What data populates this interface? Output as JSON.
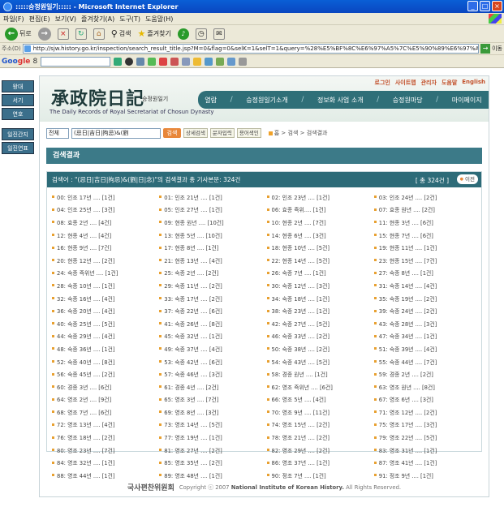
{
  "window": {
    "title": ":::::승정원일기::::: - Microsoft Internet Explorer"
  },
  "menu": [
    "파일(F)",
    "편집(E)",
    "보기(V)",
    "즐겨찾기(A)",
    "도구(T)",
    "도움말(H)"
  ],
  "toolbar": {
    "back_label": "뒤로",
    "search_label": "검색",
    "favorites_label": "즐겨찾기"
  },
  "address": {
    "label": "주소(D)",
    "url": "http://sjw.history.go.kr/inspection/search_result_title.jsp?M=0&flag=0&selK=1&selT=1&query=%28%E5%BF%8C%E6%97%A5%7C%E5%90%89%E6%97%A5",
    "after": "이동"
  },
  "google": {
    "logo_a": "Goo",
    "logo_b": "gle",
    "suffix": "8"
  },
  "left_nav": [
    "왕대",
    "서기",
    "연호",
    "일진간지",
    "월별",
    "일진연표",
    "접기"
  ],
  "header": {
    "logo_hanja": "承政院日記",
    "logo_ko": "승정원일기",
    "logo_en": "The Daily Records of Royal Secretariat of Chosun Dynasty",
    "top_links": [
      "로그인",
      "사이트맵",
      "관리자",
      "도움말",
      "English"
    ],
    "nav": [
      "열람",
      "승정원일기소개",
      "정보화 사업 소개",
      "승정원마당",
      "마이페이지"
    ]
  },
  "search": {
    "select_value": "전체",
    "query": "(忌日|吉日|拘忌)&(劉",
    "go_label": "검색",
    "options": [
      "상세검색",
      "문자입력",
      "용어색인"
    ],
    "breadcrumb": "홈 > 검색 > 검색결과"
  },
  "section_title": "검색결과",
  "results": {
    "summary": "검색어 : \"(忌日|吉日|拘忌)&(劉|日|念)\"의 검색결과 총 기사본문: 324건",
    "total": "[ 총 324건 ]",
    "prev_label": "이전",
    "items": [
      "00: 인조 17년 .... [1건]",
      "01: 인조 21년 .... [1건]",
      "02: 인조 23년 .... [1건]",
      "03: 인조 24년 .... [2건]",
      "04: 인조 25년 .... [3건]",
      "05: 인조 27년 .... [1건]",
      "06: 효종 즉위.... [1건]",
      "07: 효종 원년 .... [2건]",
      "08: 효종 2년 .... [4건]",
      "09: 현종 원년 .... [10건]",
      "10: 현종 2년 .... [7건]",
      "11: 현종 3년 .... [6건]",
      "12: 현종 4년 .... [4건]",
      "13: 현종 5년 .... [10건]",
      "14: 현종 6년 .... [3건]",
      "15: 현종 7년 .... [6건]",
      "16: 현종 9년 .... [7건]",
      "17: 현종 8년 .... [1건]",
      "18: 현종 10년 .... [5건]",
      "19: 현종 11년 .... [1건]",
      "20: 현종 12년 .... [2건]",
      "21: 현종 13년 .... [4건]",
      "22: 현종 14년 .... [5건]",
      "23: 현종 15년 .... [7건]",
      "24: 숙종 즉위년 .... [1건]",
      "25: 숙종 2년 .... [2건]",
      "26: 숙종 7년 .... [1건]",
      "27: 숙종 8년 .... [1건]",
      "28: 숙종 10년 .... [1건]",
      "29: 숙종 11년 .... [2건]",
      "30: 숙종 12년 .... [3건]",
      "31: 숙종 14년 .... [4건]",
      "32: 숙종 16년 .... [4건]",
      "33: 숙종 17년 .... [2건]",
      "34: 숙종 18년 .... [1건]",
      "35: 숙종 19년 .... [2건]",
      "36: 숙종 20년 .... [4건]",
      "37: 숙종 22년 .... [6건]",
      "38: 숙종 23년 .... [1건]",
      "39: 숙종 24년 .... [2건]",
      "40: 숙종 25년 .... [5건]",
      "41: 숙종 26년 .... [8건]",
      "42: 숙종 27년 .... [5건]",
      "43: 숙종 28년 .... [3건]",
      "44: 숙종 29년 .... [4건]",
      "45: 숙종 32년 .... [1건]",
      "46: 숙종 33년 .... [2건]",
      "47: 숙종 34년 .... [1건]",
      "48: 숙종 36년 .... [1건]",
      "49: 숙종 37년 .... [4건]",
      "50: 숙종 38년 .... [2건]",
      "51: 숙종 39년 .... [4건]",
      "52: 숙종 40년 .... [8건]",
      "53: 숙종 42년 .... [6건]",
      "54: 숙종 43년 .... [5건]",
      "55: 숙종 44년 .... [7건]",
      "56: 숙종 45년 .... [2건]",
      "57: 숙종 46년 .... [3건]",
      "58: 경종 원년 .... [1건]",
      "59: 경종 2년 .... [2건]",
      "60: 경종 3년 .... [6건]",
      "61: 경종 4년 .... [2건]",
      "62: 영조 즉위년 .... [6건]",
      "63: 영조 원년 .... [8건]",
      "64: 영조 2년 .... [9건]",
      "65: 영조 3년 .... [7건]",
      "66: 영조 5년 .... [4건]",
      "67: 영조 6년 .... [3건]",
      "68: 영조 7년 .... [6건]",
      "69: 영조 8년 .... [3건]",
      "70: 영조 9년 .... [11건]",
      "71: 영조 12년 .... [2건]",
      "72: 영조 13년 .... [4건]",
      "73: 영조 14년 .... [5건]",
      "74: 영조 15년 .... [2건]",
      "75: 영조 17년 .... [3건]",
      "76: 영조 18년 .... [2건]",
      "77: 영조 19년 .... [1건]",
      "78: 영조 21년 .... [2건]",
      "79: 영조 22년 .... [5건]",
      "80: 영조 23년 .... [7건]",
      "81: 영조 27년 .... [2건]",
      "82: 영조 29년 .... [2건]",
      "83: 영조 31년 .... [1건]",
      "84: 영조 32년 .... [1건]",
      "85: 영조 35년 .... [2건]",
      "86: 영조 37년 .... [1건]",
      "87: 영조 41년 .... [1건]",
      "88: 영조 44년 .... [1건]",
      "89: 영조 48년 .... [1건]",
      "90: 정조 7년 .... [1건]",
      "91: 정조 9년 .... [1건]"
    ]
  },
  "footer": {
    "org": "국사편찬위원회",
    "copy_prefix": "Copyright ⓒ 2007",
    "copy_org": "National Institute of Korean History.",
    "copy_suffix": "All Rights Reserved."
  }
}
